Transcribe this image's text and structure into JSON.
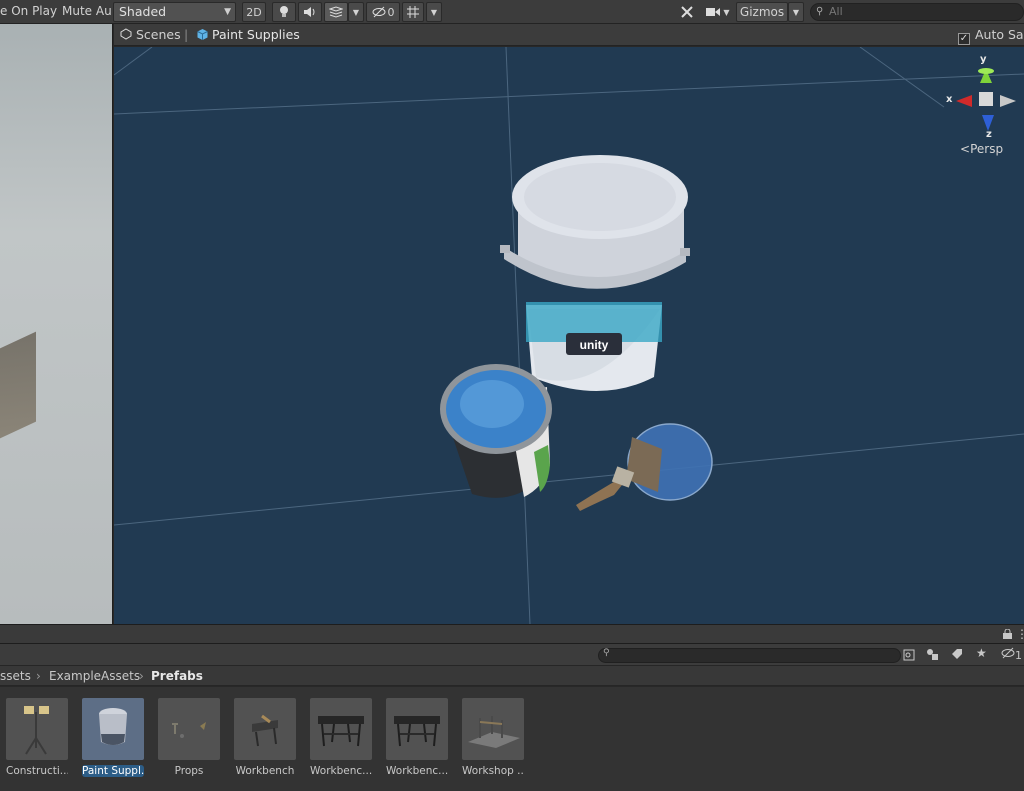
{
  "toolbar": {
    "on_play": "e On Play",
    "mute_audio": "Mute Aud",
    "shading_mode": "Shaded",
    "toggle_2d": "2D",
    "hidden_count": "0",
    "gizmos": "Gizmos",
    "search_placeholder": "All"
  },
  "scene_header": {
    "scenes_label": "Scenes",
    "separator": "|",
    "prefab_name": "Paint Supplies",
    "auto_save": "Auto Sav"
  },
  "gizmo": {
    "y": "y",
    "x": "x",
    "z": "z",
    "projection": "Persp"
  },
  "scene_objects": {
    "bucket_logo": "unity"
  },
  "project": {
    "breadcrumb": [
      "Assets",
      "ExampleAssets",
      "Prefabs"
    ],
    "breadcrumb_first": "ssets",
    "hidden_count": "1",
    "assets": [
      {
        "label": "Constructi...",
        "selected": false
      },
      {
        "label": "Paint Suppl...",
        "selected": true
      },
      {
        "label": "Props",
        "selected": false
      },
      {
        "label": "Workbench",
        "selected": false
      },
      {
        "label": "Workbenc...",
        "selected": false
      },
      {
        "label": "Workbenc...",
        "selected": false
      },
      {
        "label": "Workshop ...",
        "selected": false
      }
    ]
  },
  "colors": {
    "scene_bg": "#213a52",
    "selection": "#2c5d87",
    "toolbar": "#3c3c3c"
  }
}
